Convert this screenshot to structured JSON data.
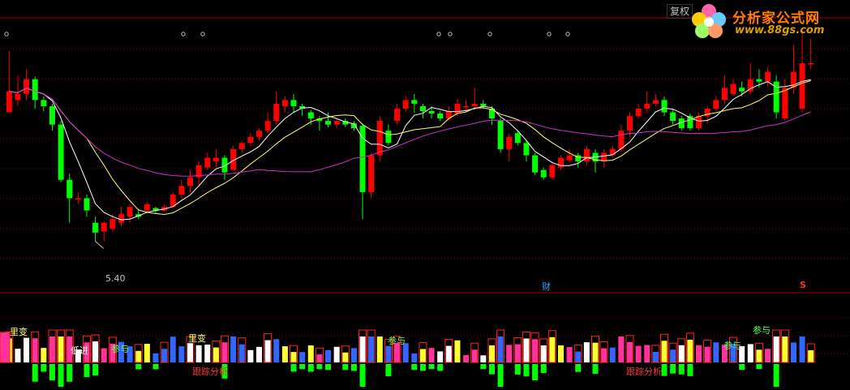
{
  "toolbar": {
    "restore_label": "复权"
  },
  "logo": {
    "title": "分析家公式网",
    "url": "www.88gs.com"
  },
  "colors": {
    "up": "#ff0000",
    "down": "#00ff00",
    "ma_short": "#ffffff",
    "ma_mid": "#ffff66",
    "ma_long": "#cc33cc",
    "grid": "#800000",
    "finance": "#3aa0ff"
  },
  "main_chart": {
    "low_marker_label": "5.40",
    "finance_marker_label": "财",
    "s_marker_label": "S"
  },
  "indicator": {
    "annotations": [
      {
        "label": "里变",
        "color": "#ffff66"
      },
      {
        "label": "低进",
        "color": "#ffffff"
      },
      {
        "label": "参与",
        "color": "#66ff66"
      },
      {
        "label": "里变",
        "color": "#ffff66"
      },
      {
        "label": "参与",
        "color": "#66ff66"
      },
      {
        "label": "参与",
        "color": "#66ff66"
      },
      {
        "label": "参与",
        "color": "#66ff66"
      },
      {
        "label": "跟踪分析",
        "color": "#ff3333"
      },
      {
        "label": "跟踪分析",
        "color": "#ff3333"
      }
    ]
  },
  "chart_data": {
    "type": "candlestick",
    "candles": [
      {
        "o": 6.45,
        "c": 6.62,
        "h": 6.95,
        "l": 6.45
      },
      {
        "o": 6.55,
        "c": 6.6,
        "h": 6.75,
        "l": 6.5
      },
      {
        "o": 6.6,
        "c": 6.72,
        "h": 6.8,
        "l": 6.55
      },
      {
        "o": 6.72,
        "c": 6.55,
        "h": 6.74,
        "l": 6.48
      },
      {
        "o": 6.55,
        "c": 6.5,
        "h": 6.58,
        "l": 6.46
      },
      {
        "o": 6.5,
        "c": 6.35,
        "h": 6.52,
        "l": 6.3
      },
      {
        "o": 6.35,
        "c": 5.9,
        "h": 6.38,
        "l": 5.88
      },
      {
        "o": 5.9,
        "c": 5.75,
        "h": 5.95,
        "l": 5.55
      },
      {
        "o": 5.75,
        "c": 5.75,
        "h": 5.8,
        "l": 5.7
      },
      {
        "o": 5.75,
        "c": 5.65,
        "h": 5.78,
        "l": 5.6
      },
      {
        "o": 5.55,
        "c": 5.47,
        "h": 5.6,
        "l": 5.4
      },
      {
        "o": 5.48,
        "c": 5.55,
        "h": 5.56,
        "l": 5.4
      },
      {
        "o": 5.5,
        "c": 5.58,
        "h": 5.62,
        "l": 5.48
      },
      {
        "o": 5.55,
        "c": 5.62,
        "h": 5.68,
        "l": 5.52
      },
      {
        "o": 5.6,
        "c": 5.68,
        "h": 5.7,
        "l": 5.55
      },
      {
        "o": 5.62,
        "c": 5.6,
        "h": 5.66,
        "l": 5.58
      },
      {
        "o": 5.65,
        "c": 5.7,
        "h": 5.72,
        "l": 5.63
      },
      {
        "o": 5.67,
        "c": 5.65,
        "h": 5.68,
        "l": 5.62
      },
      {
        "o": 5.65,
        "c": 5.68,
        "h": 5.7,
        "l": 5.64
      },
      {
        "o": 5.68,
        "c": 5.78,
        "h": 5.8,
        "l": 5.67
      },
      {
        "o": 5.78,
        "c": 5.85,
        "h": 5.9,
        "l": 5.75
      },
      {
        "o": 5.85,
        "c": 5.92,
        "h": 5.98,
        "l": 5.8
      },
      {
        "o": 5.92,
        "c": 6.02,
        "h": 6.05,
        "l": 5.85
      },
      {
        "o": 6.0,
        "c": 6.08,
        "h": 6.12,
        "l": 5.98
      },
      {
        "o": 6.05,
        "c": 6.08,
        "h": 6.15,
        "l": 6.0
      },
      {
        "o": 6.08,
        "c": 5.96,
        "h": 6.1,
        "l": 5.9
      },
      {
        "o": 5.98,
        "c": 6.15,
        "h": 6.18,
        "l": 5.98
      },
      {
        "o": 6.15,
        "c": 6.2,
        "h": 6.22,
        "l": 6.12
      },
      {
        "o": 6.2,
        "c": 6.25,
        "h": 6.28,
        "l": 6.18
      },
      {
        "o": 6.25,
        "c": 6.3,
        "h": 6.32,
        "l": 6.22
      },
      {
        "o": 6.3,
        "c": 6.38,
        "h": 6.45,
        "l": 6.28
      },
      {
        "o": 6.38,
        "c": 6.52,
        "h": 6.62,
        "l": 6.35
      },
      {
        "o": 6.5,
        "c": 6.55,
        "h": 6.58,
        "l": 6.45
      },
      {
        "o": 6.55,
        "c": 6.5,
        "h": 6.6,
        "l": 6.45
      },
      {
        "o": 6.5,
        "c": 6.48,
        "h": 6.52,
        "l": 6.42
      },
      {
        "o": 6.45,
        "c": 6.4,
        "h": 6.47,
        "l": 6.35
      },
      {
        "o": 6.4,
        "c": 6.38,
        "h": 6.42,
        "l": 6.3
      },
      {
        "o": 6.38,
        "c": 6.35,
        "h": 6.45,
        "l": 6.33
      },
      {
        "o": 6.35,
        "c": 6.38,
        "h": 6.4,
        "l": 6.32
      },
      {
        "o": 6.38,
        "c": 6.35,
        "h": 6.4,
        "l": 6.33
      },
      {
        "o": 6.36,
        "c": 6.32,
        "h": 6.38,
        "l": 6.3
      },
      {
        "o": 6.34,
        "c": 5.8,
        "h": 6.36,
        "l": 5.58
      },
      {
        "o": 5.8,
        "c": 6.1,
        "h": 6.12,
        "l": 5.75
      },
      {
        "o": 6.1,
        "c": 6.38,
        "h": 6.42,
        "l": 6.05
      },
      {
        "o": 6.3,
        "c": 6.2,
        "h": 6.35,
        "l": 6.18
      },
      {
        "o": 6.38,
        "c": 6.48,
        "h": 6.52,
        "l": 6.35
      },
      {
        "o": 6.48,
        "c": 6.55,
        "h": 6.58,
        "l": 6.45
      },
      {
        "o": 6.55,
        "c": 6.52,
        "h": 6.6,
        "l": 6.45
      },
      {
        "o": 6.5,
        "c": 6.46,
        "h": 6.52,
        "l": 6.4
      },
      {
        "o": 6.46,
        "c": 6.44,
        "h": 6.5,
        "l": 6.4
      },
      {
        "o": 6.44,
        "c": 6.4,
        "h": 6.46,
        "l": 6.38
      },
      {
        "o": 6.4,
        "c": 6.46,
        "h": 6.5,
        "l": 6.38
      },
      {
        "o": 6.44,
        "c": 6.52,
        "h": 6.56,
        "l": 6.42
      },
      {
        "o": 6.5,
        "c": 6.5,
        "h": 6.55,
        "l": 6.45
      },
      {
        "o": 6.5,
        "c": 6.52,
        "h": 6.65,
        "l": 6.48
      },
      {
        "o": 6.52,
        "c": 6.5,
        "h": 6.55,
        "l": 6.48
      },
      {
        "o": 6.48,
        "c": 6.4,
        "h": 6.5,
        "l": 6.35
      },
      {
        "o": 6.38,
        "c": 6.15,
        "h": 6.4,
        "l": 6.12
      },
      {
        "o": 6.15,
        "c": 6.25,
        "h": 6.28,
        "l": 6.05
      },
      {
        "o": 6.28,
        "c": 6.2,
        "h": 6.3,
        "l": 6.18
      },
      {
        "o": 6.2,
        "c": 6.1,
        "h": 6.22,
        "l": 6.05
      },
      {
        "o": 6.1,
        "c": 5.96,
        "h": 6.12,
        "l": 5.94
      },
      {
        "o": 5.98,
        "c": 5.92,
        "h": 6.0,
        "l": 5.9
      },
      {
        "o": 5.92,
        "c": 6.02,
        "h": 6.05,
        "l": 5.9
      },
      {
        "o": 6.0,
        "c": 6.08,
        "h": 6.1,
        "l": 5.98
      },
      {
        "o": 6.06,
        "c": 6.1,
        "h": 6.15,
        "l": 6.04
      },
      {
        "o": 6.1,
        "c": 6.05,
        "h": 6.12,
        "l": 6.0
      },
      {
        "o": 6.05,
        "c": 6.15,
        "h": 6.18,
        "l": 6.02
      },
      {
        "o": 6.12,
        "c": 6.05,
        "h": 6.15,
        "l": 5.96
      },
      {
        "o": 6.05,
        "c": 6.12,
        "h": 6.15,
        "l": 6.0
      },
      {
        "o": 6.1,
        "c": 6.15,
        "h": 6.18,
        "l": 6.08
      },
      {
        "o": 6.15,
        "c": 6.3,
        "h": 6.35,
        "l": 6.12
      },
      {
        "o": 6.3,
        "c": 6.42,
        "h": 6.45,
        "l": 6.25
      },
      {
        "o": 6.42,
        "c": 6.48,
        "h": 6.52,
        "l": 6.4
      },
      {
        "o": 6.48,
        "c": 6.52,
        "h": 6.62,
        "l": 6.45
      },
      {
        "o": 6.52,
        "c": 6.55,
        "h": 6.6,
        "l": 6.5
      },
      {
        "o": 6.55,
        "c": 6.45,
        "h": 6.58,
        "l": 6.42
      },
      {
        "o": 6.45,
        "c": 6.38,
        "h": 6.48,
        "l": 6.35
      },
      {
        "o": 6.4,
        "c": 6.32,
        "h": 6.42,
        "l": 6.3
      },
      {
        "o": 6.42,
        "c": 6.32,
        "h": 6.44,
        "l": 6.3
      },
      {
        "o": 6.32,
        "c": 6.42,
        "h": 6.45,
        "l": 6.3
      },
      {
        "o": 6.42,
        "c": 6.48,
        "h": 6.5,
        "l": 6.36
      },
      {
        "o": 6.48,
        "c": 6.55,
        "h": 6.58,
        "l": 6.46
      },
      {
        "o": 6.55,
        "c": 6.65,
        "h": 6.75,
        "l": 6.52
      },
      {
        "o": 6.6,
        "c": 6.68,
        "h": 6.72,
        "l": 6.58
      },
      {
        "o": 6.65,
        "c": 6.62,
        "h": 6.7,
        "l": 6.58
      },
      {
        "o": 6.62,
        "c": 6.72,
        "h": 6.85,
        "l": 6.6
      },
      {
        "o": 6.72,
        "c": 6.7,
        "h": 6.8,
        "l": 6.65
      },
      {
        "o": 6.7,
        "c": 6.78,
        "h": 6.82,
        "l": 6.66
      },
      {
        "o": 6.7,
        "c": 6.45,
        "h": 6.75,
        "l": 6.4
      },
      {
        "o": 6.4,
        "c": 6.65,
        "h": 6.72,
        "l": 6.38
      },
      {
        "o": 6.65,
        "c": 6.78,
        "h": 7.0,
        "l": 6.6
      },
      {
        "o": 6.48,
        "c": 6.85,
        "h": 7.1,
        "l": 6.45
      },
      {
        "o": 6.85,
        "c": 6.85,
        "h": 7.05,
        "l": 6.8
      }
    ]
  }
}
